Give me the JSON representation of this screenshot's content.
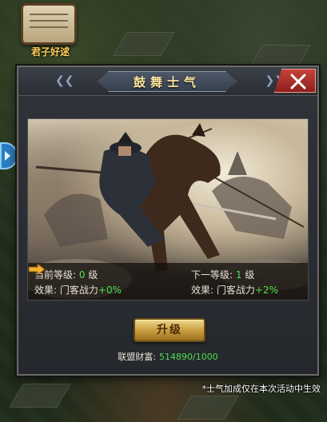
{
  "map": {
    "quest_label": "君子好逑",
    "quest_icon": "scroll-icon",
    "side_tab_icon": "expand-arrow-icon"
  },
  "dialog": {
    "title": "鼓舞士气",
    "close_icon": "close-icon",
    "illustration": "cavalry-battle-illustration",
    "current": {
      "level_label": "当前等级:",
      "level_value": "0",
      "level_unit": "级",
      "effect_label": "效果:",
      "effect_text": "门客战力",
      "effect_bonus": "+0%"
    },
    "next": {
      "level_label": "下一等级:",
      "level_value": "1",
      "level_unit": "级",
      "effect_label": "效果:",
      "effect_text": "门客战力",
      "effect_bonus": "+2%"
    },
    "arrow_icon": "right-arrow-icon",
    "upgrade_label": "升级",
    "wealth_label": "联盟财富:",
    "wealth_value": "514890/1000"
  },
  "footnote": "*士气加成仅在本次活动中生效",
  "colors": {
    "highlight_green": "#4ee04e",
    "title_gold": "#ffe7a0",
    "close_red": "#c5413a",
    "button_gold": "#c69a3a"
  }
}
